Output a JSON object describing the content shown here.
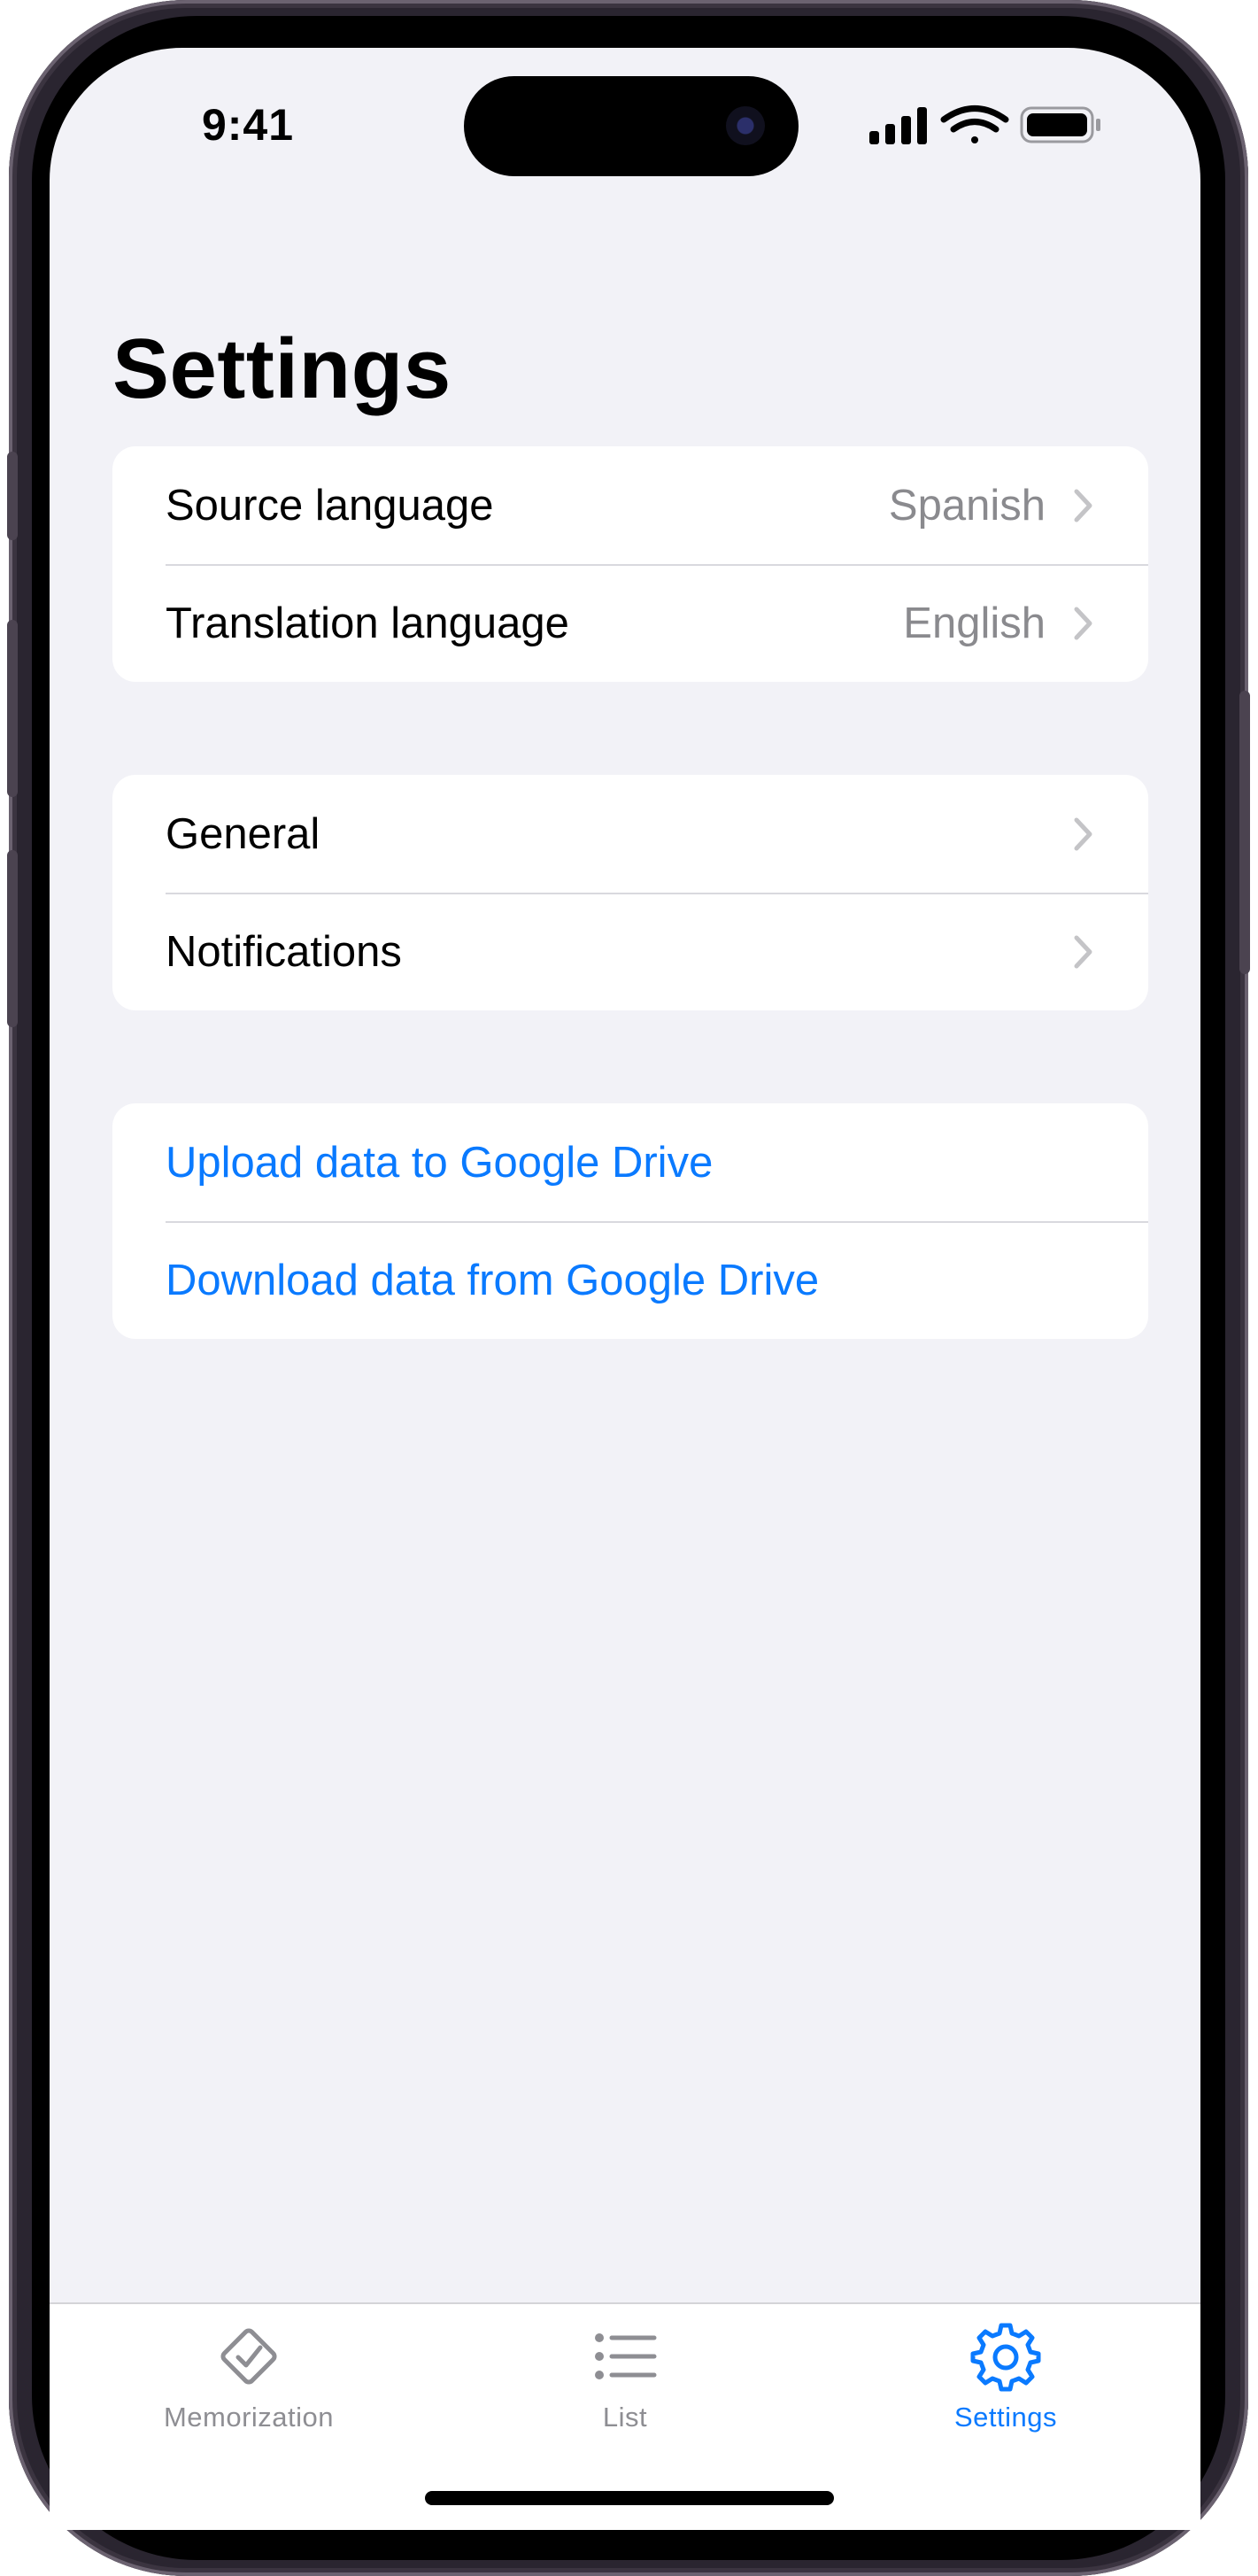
{
  "status_bar": {
    "time": "9:41"
  },
  "page": {
    "title": "Settings"
  },
  "language_group": {
    "source_label": "Source language",
    "source_value": "Spanish",
    "translation_label": "Translation language",
    "translation_value": "English"
  },
  "prefs_group": {
    "general_label": "General",
    "notifications_label": "Notifications"
  },
  "drive_group": {
    "upload_label": "Upload data to Google Drive",
    "download_label": "Download data from Google Drive"
  },
  "tab_bar": {
    "tabs": [
      {
        "label": "Memorization",
        "icon": "diamond-checkmark-icon",
        "selected": false
      },
      {
        "label": "List",
        "icon": "list-bullet-icon",
        "selected": false
      },
      {
        "label": "Settings",
        "icon": "gear-icon",
        "selected": true
      }
    ]
  },
  "colors": {
    "accent": "#0a7aff",
    "inactive": "#8e8e93",
    "background": "#f2f2f7",
    "secondary_text": "#8a8a8e"
  }
}
